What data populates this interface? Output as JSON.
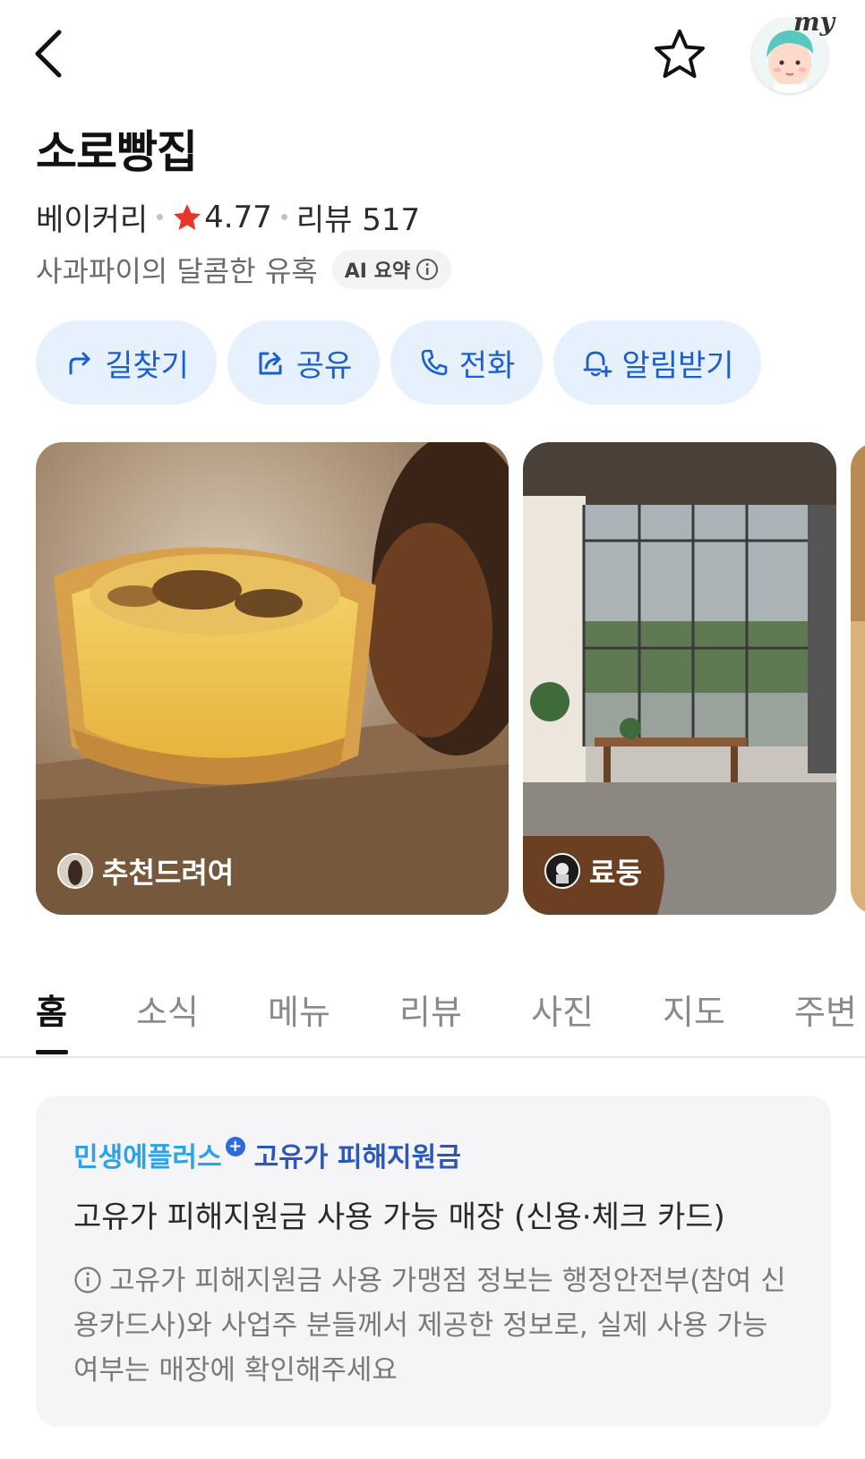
{
  "header": {
    "back_icon": "chevron-left-icon",
    "favorite_icon": "star-outline-icon",
    "my_label": "my"
  },
  "place": {
    "name": "소로빵집",
    "category": "베이커리",
    "rating": "4.77",
    "review_label": "리뷰 517",
    "summary": "사과파이의 달콤한 유혹",
    "ai_chip": "AI 요약",
    "rating_star_color": "#e8362b"
  },
  "actions": [
    {
      "label": "길찾기",
      "icon": "directions-icon"
    },
    {
      "label": "공유",
      "icon": "share-icon"
    },
    {
      "label": "전화",
      "icon": "phone-icon"
    },
    {
      "label": "알림받기",
      "icon": "bell-plus-icon"
    }
  ],
  "photos": [
    {
      "user": "추천드려여",
      "subject": "egg-tart"
    },
    {
      "user": "료둥",
      "subject": "cafe-interior"
    }
  ],
  "tabs": [
    {
      "label": "홈",
      "active": true
    },
    {
      "label": "소식"
    },
    {
      "label": "메뉴"
    },
    {
      "label": "리뷰"
    },
    {
      "label": "사진"
    },
    {
      "label": "지도"
    },
    {
      "label": "주변"
    }
  ],
  "support_card": {
    "brand_primary": "민생에플러스",
    "brand_plus": "+",
    "brand_secondary": "고유가 피해지원금",
    "headline": "고유가 피해지원금 사용 가능 매장 (신용·체크 카드)",
    "notice": "고유가 피해지원금 사용 가맹점 정보는 행정안전부(참여 신용카드사)와 사업주 분들께서 제공한 정보로, 실제 사용 가능 여부는 매장에 확인해주세요"
  },
  "colors": {
    "accent_blue": "#1b5fcc",
    "action_bg": "#e7f1fd",
    "card_bg": "#f5f5f7"
  }
}
